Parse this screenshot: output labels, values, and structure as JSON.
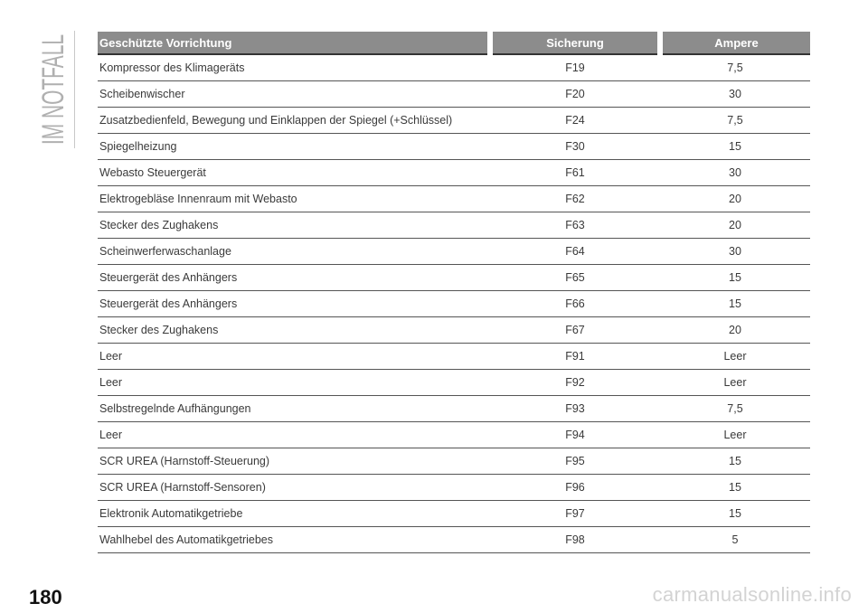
{
  "section_title": "IM NOTFALL",
  "table": {
    "headers": [
      "Geschützte Vorrichtung",
      "Sicherung",
      "Ampere"
    ],
    "rows": [
      [
        "Kompressor des Klimageräts",
        "F19",
        "7,5"
      ],
      [
        "Scheibenwischer",
        "F20",
        "30"
      ],
      [
        "Zusatzbedienfeld, Bewegung und Einklappen der Spiegel (+Schlüssel)",
        "F24",
        "7,5"
      ],
      [
        "Spiegelheizung",
        "F30",
        "15"
      ],
      [
        "Webasto Steuergerät",
        "F61",
        "30"
      ],
      [
        "Elektrogebläse Innenraum mit Webasto",
        "F62",
        "20"
      ],
      [
        "Stecker des Zughakens",
        "F63",
        "20"
      ],
      [
        "Scheinwerferwaschanlage",
        "F64",
        "30"
      ],
      [
        "Steuergerät des Anhängers",
        "F65",
        "15"
      ],
      [
        "Steuergerät des Anhängers",
        "F66",
        "15"
      ],
      [
        "Stecker des Zughakens",
        "F67",
        "20"
      ],
      [
        "Leer",
        "F91",
        "Leer"
      ],
      [
        "Leer",
        "F92",
        "Leer"
      ],
      [
        "Selbstregelnde Aufhängungen",
        "F93",
        "7,5"
      ],
      [
        "Leer",
        "F94",
        "Leer"
      ],
      [
        "SCR UREA (Harnstoff-Steuerung)",
        "F95",
        "15"
      ],
      [
        "SCR UREA (Harnstoff-Sensoren)",
        "F96",
        "15"
      ],
      [
        "Elektronik Automatikgetriebe",
        "F97",
        "15"
      ],
      [
        "Wahlhebel des Automatikgetriebes",
        "F98",
        "5"
      ]
    ]
  },
  "page_number": "180",
  "watermark": "carmanualsonline.info"
}
